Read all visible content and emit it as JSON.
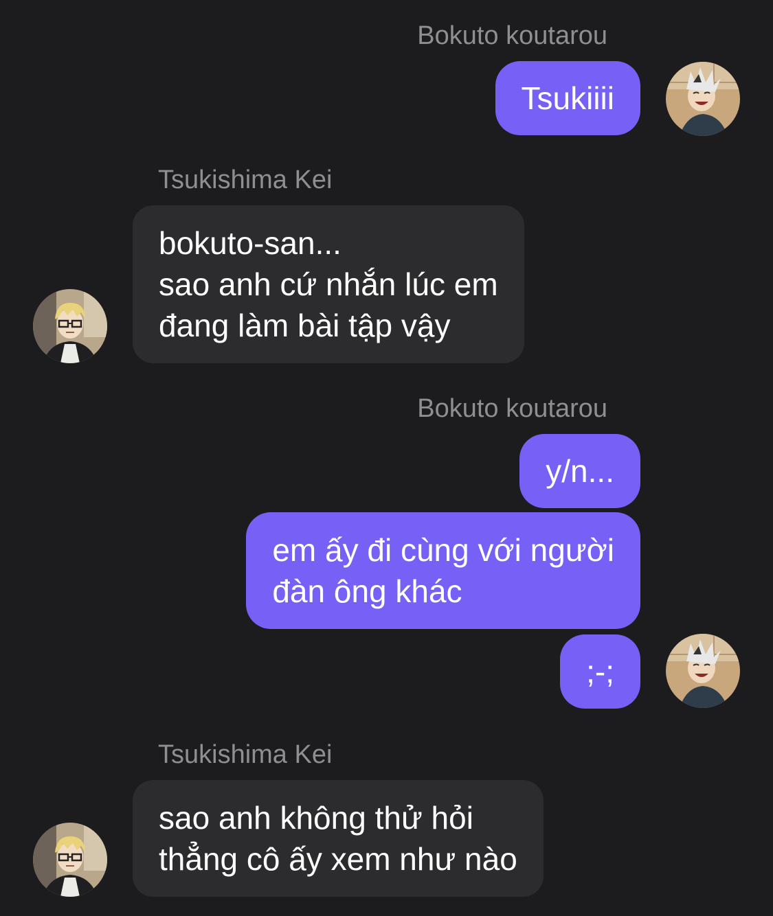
{
  "messages": [
    {
      "sender": "Bokuto koutarou",
      "side": "right",
      "bubbles": [
        "Tsukiiii"
      ]
    },
    {
      "sender": "Tsukishima Kei",
      "side": "left",
      "bubbles": [
        [
          "bokuto-san...",
          "sao anh cứ nhắn lúc em",
          "đang làm bài tập vậy"
        ]
      ]
    },
    {
      "sender": "Bokuto koutarou",
      "side": "right",
      "bubbles": [
        "y/n...",
        [
          "em ấy đi cùng với người",
          "đàn ông khác"
        ],
        ";-;"
      ]
    },
    {
      "sender": "Tsukishima Kei",
      "side": "left",
      "bubbles": [
        [
          "sao anh không thử hỏi",
          "thẳng cô ấy xem như nào"
        ]
      ]
    }
  ],
  "colors": {
    "background": "#1c1c1e",
    "outgoing_bubble": "#7660f5",
    "incoming_bubble": "#2c2c2e",
    "sender_name": "#8e8e93"
  },
  "icons": {
    "bokuto_avatar": "avatar-bokuto-icon",
    "tsukishima_avatar": "avatar-tsukishima-icon"
  }
}
